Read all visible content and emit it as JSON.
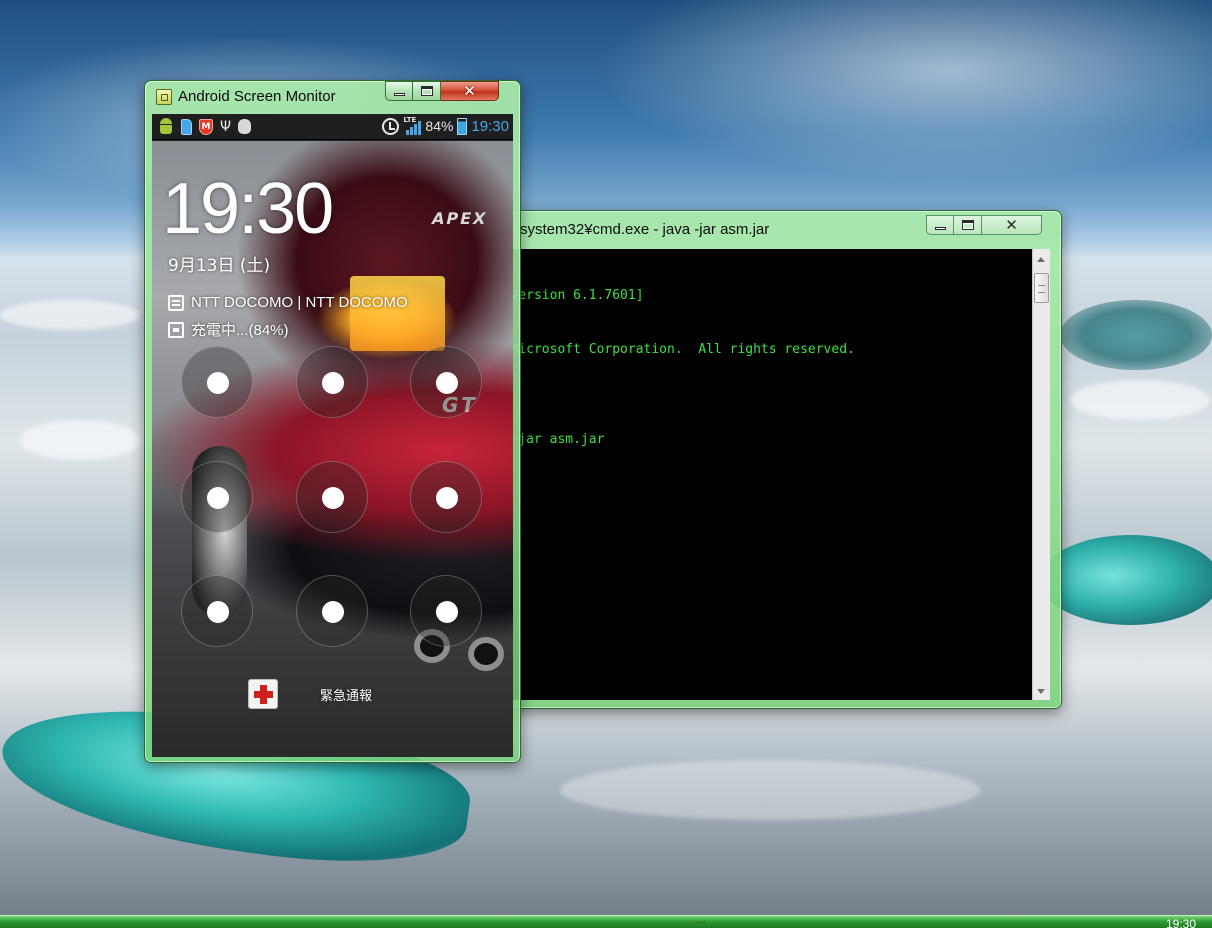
{
  "desktop": {
    "taskbar": {
      "clock": "19:30",
      "grip": "..."
    }
  },
  "console_window": {
    "title": "system32¥cmd.exe - java  -jar asm.jar",
    "lines": [
      "s [Version 6.1.7601]",
      "09 Microsoft Corporation.  All rights reserved.",
      "",
      "va -jar asm.jar"
    ],
    "text_color": "#3ee03e"
  },
  "asm_window": {
    "title": "Android Screen Monitor",
    "frame_color": "#7fd27f",
    "status_bar": {
      "left_icons": [
        "android-debug-icon",
        "sim-card-icon",
        "security-shield-icon",
        "usb-icon",
        "bug-icon"
      ],
      "shield_letter": "M",
      "usb_glyph": "Ψ",
      "right_icons": [
        "alarm-icon",
        "lte-signal-icon",
        "battery-icon"
      ],
      "network_type": "LTE",
      "battery_percent": "84%",
      "clock": "19:30"
    },
    "lockscreen": {
      "time": "19:30",
      "date": "9月13日 (土)",
      "carrier": "NTT DOCOMO | NTT DOCOMO",
      "charging": "充電中...(84%)",
      "wallpaper_text": {
        "logo": "APEX",
        "badge": "GT"
      },
      "pattern_dots": 9,
      "emergency_label": "緊急通報"
    }
  },
  "icons": [
    "app-icon",
    "minimize-icon",
    "maximize-icon",
    "close-icon"
  ]
}
